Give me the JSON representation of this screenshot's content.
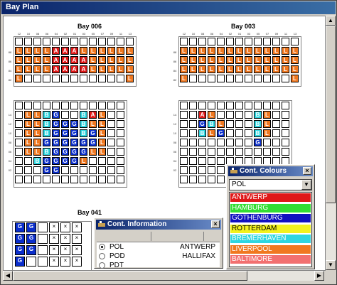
{
  "window": {
    "title": "Bay Plan"
  },
  "bays": [
    {
      "title": "Bay 006",
      "cols": [
        "12",
        "10",
        "08",
        "06",
        "04",
        "02",
        "01",
        "03",
        "05",
        "07",
        "09",
        "11",
        "13"
      ],
      "deck_rows": [
        "88",
        "86",
        "84",
        "82"
      ],
      "hold_rows": [
        "14",
        "12",
        "10",
        "08",
        "06",
        "04",
        "02"
      ],
      "deck": [
        [
          "",
          "",
          "",
          "",
          "",
          "",
          "",
          "",
          "",
          "",
          "",
          "",
          ""
        ],
        [
          "L",
          "L",
          "L",
          "L",
          "A",
          "A",
          "A",
          "L",
          "L",
          "L",
          "L",
          "L",
          "L"
        ],
        [
          "L",
          "L",
          "L",
          "L",
          "A",
          "A",
          "A",
          "A",
          "L",
          "L",
          "L",
          "L",
          "L"
        ],
        [
          "L",
          "L",
          "L",
          "L",
          "A",
          "A",
          "A",
          "A",
          "L",
          "L",
          "L",
          "L",
          "L"
        ],
        [
          "L",
          "",
          "",
          "",
          "",
          "",
          "",
          "",
          "",
          "",
          "",
          "",
          "L"
        ]
      ],
      "hold": [
        [
          "",
          "",
          "",
          "",
          "",
          "",
          "",
          "",
          "",
          "",
          "",
          ""
        ],
        [
          "",
          "L",
          "L",
          "B",
          "G",
          "",
          "",
          "B",
          "A",
          "L",
          "",
          ""
        ],
        [
          "",
          "L",
          "L",
          "B",
          "G",
          "G",
          "G",
          "B",
          "L",
          "L",
          "",
          ""
        ],
        [
          "",
          "L",
          "L",
          "B",
          "G",
          "G",
          "G",
          "B",
          "G",
          "L",
          "",
          ""
        ],
        [
          "",
          "L",
          "L",
          "G",
          "G",
          "G",
          "G",
          "G",
          "G",
          "L",
          "",
          ""
        ],
        [
          "",
          "L",
          "L",
          "B",
          "G",
          "G",
          "G",
          "G",
          "L",
          "L",
          "",
          ""
        ],
        [
          "",
          "",
          "B",
          "G",
          "G",
          "G",
          "G",
          "L",
          "",
          "",
          "",
          ""
        ],
        [
          "",
          "",
          "",
          "G",
          "G",
          "",
          "",
          "",
          "",
          "",
          "",
          ""
        ],
        [
          "",
          "",
          "",
          "",
          "",
          "",
          "",
          "",
          "",
          "",
          "",
          ""
        ]
      ]
    },
    {
      "title": "Bay 003",
      "cols": [
        "12",
        "10",
        "08",
        "06",
        "04",
        "02",
        "01",
        "03",
        "05",
        "07",
        "09",
        "11",
        "13"
      ],
      "deck_rows": [
        "88",
        "86",
        "84",
        "82"
      ],
      "hold_rows": [
        "14",
        "12",
        "10",
        "08",
        "06",
        "04",
        "02"
      ],
      "deck": [
        [
          "",
          "",
          "",
          "",
          "",
          "",
          "",
          "",
          "",
          "",
          "",
          "",
          ""
        ],
        [
          "L",
          "L",
          "L",
          "L",
          "L",
          "L",
          "L",
          "L",
          "L",
          "L",
          "L",
          "L",
          "L"
        ],
        [
          "L",
          "L",
          "L",
          "L",
          "L",
          "L",
          "L",
          "L",
          "L",
          "L",
          "L",
          "L",
          "L"
        ],
        [
          "L",
          "L",
          "L",
          "L",
          "L",
          "L",
          "L",
          "L",
          "L",
          "L",
          "L",
          "L",
          "L"
        ],
        [
          "L",
          "",
          "",
          "",
          "",
          "",
          "",
          "",
          "",
          "",
          "",
          "",
          "L"
        ]
      ],
      "hold": [
        [
          "",
          "",
          "",
          "",
          "",
          "",
          "",
          "",
          "",
          "",
          "",
          ""
        ],
        [
          "",
          "",
          "A",
          "L",
          "",
          "",
          "",
          "",
          "B",
          "L",
          "",
          ""
        ],
        [
          "",
          "",
          "G",
          "B",
          "L",
          "",
          "",
          "",
          "B",
          "L",
          "",
          ""
        ],
        [
          "",
          "",
          "B",
          "L",
          "G",
          "",
          "",
          "",
          "B",
          "L",
          "",
          ""
        ],
        [
          "",
          "",
          "",
          "",
          "",
          "",
          "",
          "",
          "G",
          "",
          "",
          ""
        ],
        [
          "",
          "",
          "",
          "",
          "",
          "",
          "",
          "",
          "",
          "",
          "",
          ""
        ],
        [
          "",
          "",
          "",
          "",
          "",
          "",
          "",
          "",
          "",
          "",
          "",
          ""
        ],
        [
          "",
          "",
          "",
          "",
          "",
          "",
          "",
          "",
          "",
          "",
          "",
          ""
        ],
        [
          "",
          "",
          "",
          "",
          "",
          "",
          "",
          "",
          "",
          "",
          "",
          ""
        ]
      ]
    },
    {
      "title": "Bay 041",
      "rows": [
        [
          "G",
          "G",
          "",
          "X",
          "X",
          "X"
        ],
        [
          "G",
          "G",
          "",
          "X",
          "X",
          "X"
        ],
        [
          "G",
          "G",
          "",
          "X",
          "X",
          "X"
        ],
        [
          "G",
          "",
          "",
          "X",
          "X",
          "X"
        ]
      ]
    }
  ],
  "cont_colours": {
    "title": "Cont. Colours",
    "selected": "POL",
    "items": [
      {
        "label": "ANTWERP",
        "bg": "#e01818",
        "fg": "#ffffff"
      },
      {
        "label": "HAMBURG",
        "bg": "#33dd33",
        "fg": "#ffffff"
      },
      {
        "label": "GOTHENBURG",
        "bg": "#1010c0",
        "fg": "#ffffff"
      },
      {
        "label": "ROTTERDAM",
        "bg": "#f2f21e",
        "fg": "#000000"
      },
      {
        "label": "BREMERHAVEN",
        "bg": "#2ed6e0",
        "fg": "#ffffff"
      },
      {
        "label": "LIVERPOOL",
        "bg": "#f07820",
        "fg": "#ffffff"
      },
      {
        "label": "BALTIMORE",
        "bg": "#f27070",
        "fg": "#ffffff"
      }
    ]
  },
  "cont_info": {
    "title": "Cont. Information",
    "rows": [
      {
        "key": "POL",
        "value": "ANTWERP",
        "checked": true
      },
      {
        "key": "POD",
        "value": "HALLIFAX",
        "checked": false
      },
      {
        "key": "PDT",
        "value": "",
        "checked": false
      }
    ]
  },
  "icons": {
    "close": "close-icon",
    "app": "ship-icon",
    "scroll_up": "arrow-up-icon",
    "scroll_down": "arrow-down-icon",
    "scroll_left": "arrow-left-icon",
    "scroll_right": "arrow-right-icon",
    "dropdown": "chevron-down-icon"
  }
}
